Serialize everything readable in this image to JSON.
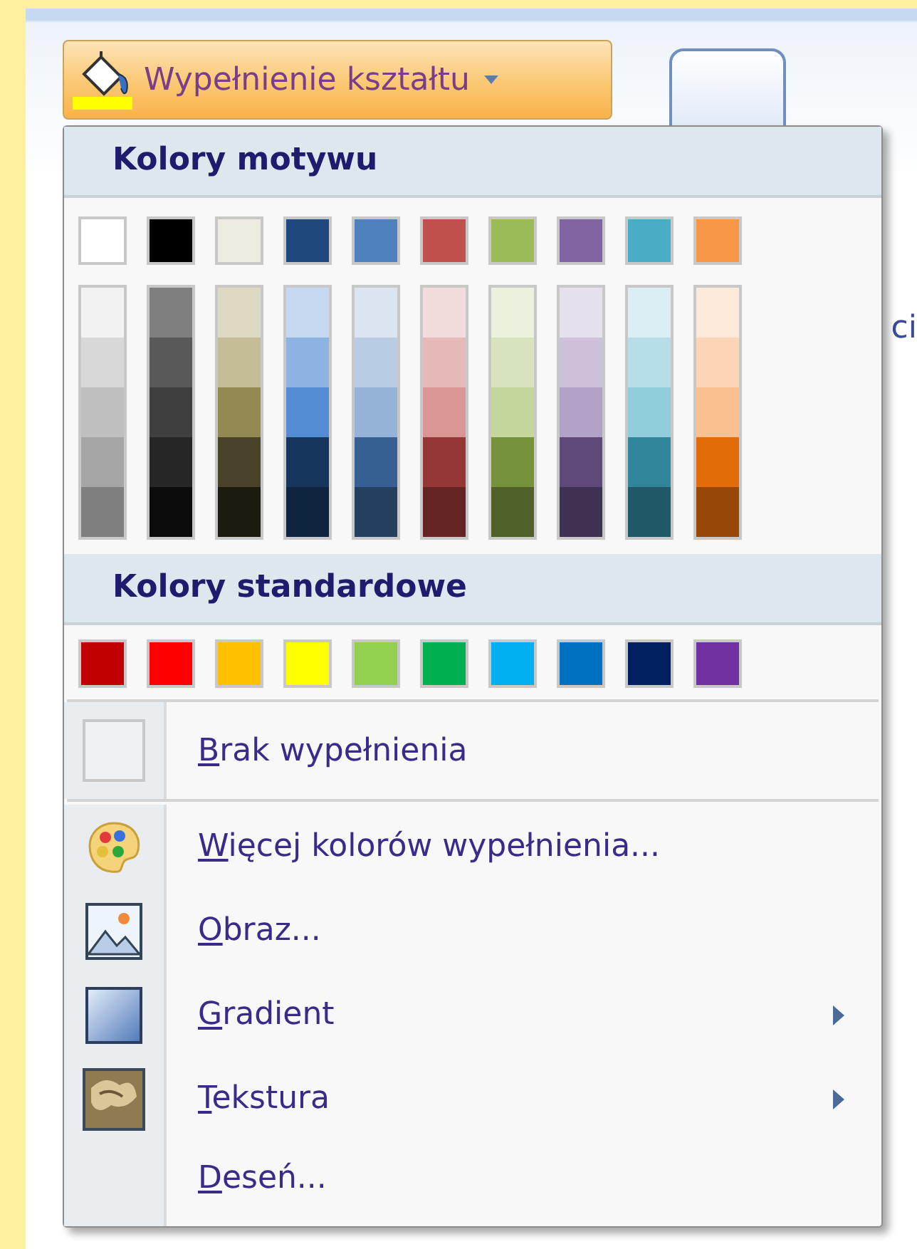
{
  "ribbon": {
    "fill_button": {
      "label": "Wypełnienie kształtu"
    },
    "cut_text": "ci"
  },
  "menu": {
    "theme_heading": "Kolory motywu",
    "theme_colors": [
      {
        "color": "#ffffff",
        "shades": [
          {
            "color": "#f2f2f2"
          },
          {
            "color": "#d8d8d8"
          },
          {
            "color": "#bfbfbf"
          },
          {
            "color": "#a5a5a5"
          },
          {
            "color": "#7f7f7f"
          }
        ]
      },
      {
        "color": "#000000",
        "shades": [
          {
            "color": "#7f7f7f"
          },
          {
            "color": "#595959"
          },
          {
            "color": "#3f3f3f"
          },
          {
            "color": "#262626"
          },
          {
            "color": "#0c0c0c"
          }
        ]
      },
      {
        "color": "#eeece1",
        "shades": [
          {
            "color": "#ddd9c3"
          },
          {
            "color": "#c4bd97"
          },
          {
            "color": "#938953"
          },
          {
            "color": "#494429"
          },
          {
            "color": "#1d1b10"
          }
        ]
      },
      {
        "color": "#1f497d",
        "shades": [
          {
            "color": "#c6d9f0"
          },
          {
            "color": "#8db3e2"
          },
          {
            "color": "#548dd4"
          },
          {
            "color": "#17365d"
          },
          {
            "color": "#0f243e"
          }
        ]
      },
      {
        "color": "#4f81bd",
        "shades": [
          {
            "color": "#dbe5f1"
          },
          {
            "color": "#b8cce4"
          },
          {
            "color": "#95b3d7"
          },
          {
            "color": "#366092"
          },
          {
            "color": "#244061"
          }
        ]
      },
      {
        "color": "#c0504d",
        "shades": [
          {
            "color": "#f2dcdb"
          },
          {
            "color": "#e5b9b7"
          },
          {
            "color": "#d99694"
          },
          {
            "color": "#953734"
          },
          {
            "color": "#632423"
          }
        ]
      },
      {
        "color": "#9bbb59",
        "shades": [
          {
            "color": "#ebf1dd"
          },
          {
            "color": "#d7e3bc"
          },
          {
            "color": "#c3d69b"
          },
          {
            "color": "#76923c"
          },
          {
            "color": "#4f6128"
          }
        ]
      },
      {
        "color": "#8064a2",
        "shades": [
          {
            "color": "#e5e0ec"
          },
          {
            "color": "#ccc1d9"
          },
          {
            "color": "#b2a2c7"
          },
          {
            "color": "#5f497a"
          },
          {
            "color": "#3f3151"
          }
        ]
      },
      {
        "color": "#4bacc6",
        "shades": [
          {
            "color": "#dbeef3"
          },
          {
            "color": "#b7dde8"
          },
          {
            "color": "#92cddc"
          },
          {
            "color": "#31859b"
          },
          {
            "color": "#205867"
          }
        ]
      },
      {
        "color": "#f79646",
        "shades": [
          {
            "color": "#fdeada"
          },
          {
            "color": "#fbd5b5"
          },
          {
            "color": "#fac08f"
          },
          {
            "color": "#e36c09"
          },
          {
            "color": "#974806"
          }
        ]
      }
    ],
    "standard_heading": "Kolory standardowe",
    "standard_colors": [
      {
        "color": "#c00000"
      },
      {
        "color": "#ff0000"
      },
      {
        "color": "#ffc000"
      },
      {
        "color": "#ffff00"
      },
      {
        "color": "#92d050"
      },
      {
        "color": "#00b050"
      },
      {
        "color": "#00b0f0"
      },
      {
        "color": "#0070c0"
      },
      {
        "color": "#002060"
      },
      {
        "color": "#7030a0"
      }
    ],
    "no_fill": {
      "label": "Brak wypełnienia"
    },
    "items": [
      {
        "kind": "colors",
        "label": "Więcej kolorów wypełnienia...",
        "submenu": false
      },
      {
        "kind": "picture",
        "label": "Obraz...",
        "submenu": false
      },
      {
        "kind": "gradient",
        "label": "Gradient",
        "submenu": true
      },
      {
        "kind": "texture",
        "label": "Tekstura",
        "submenu": true
      },
      {
        "kind": "pattern",
        "label": "Deseń...",
        "submenu": false
      }
    ]
  }
}
